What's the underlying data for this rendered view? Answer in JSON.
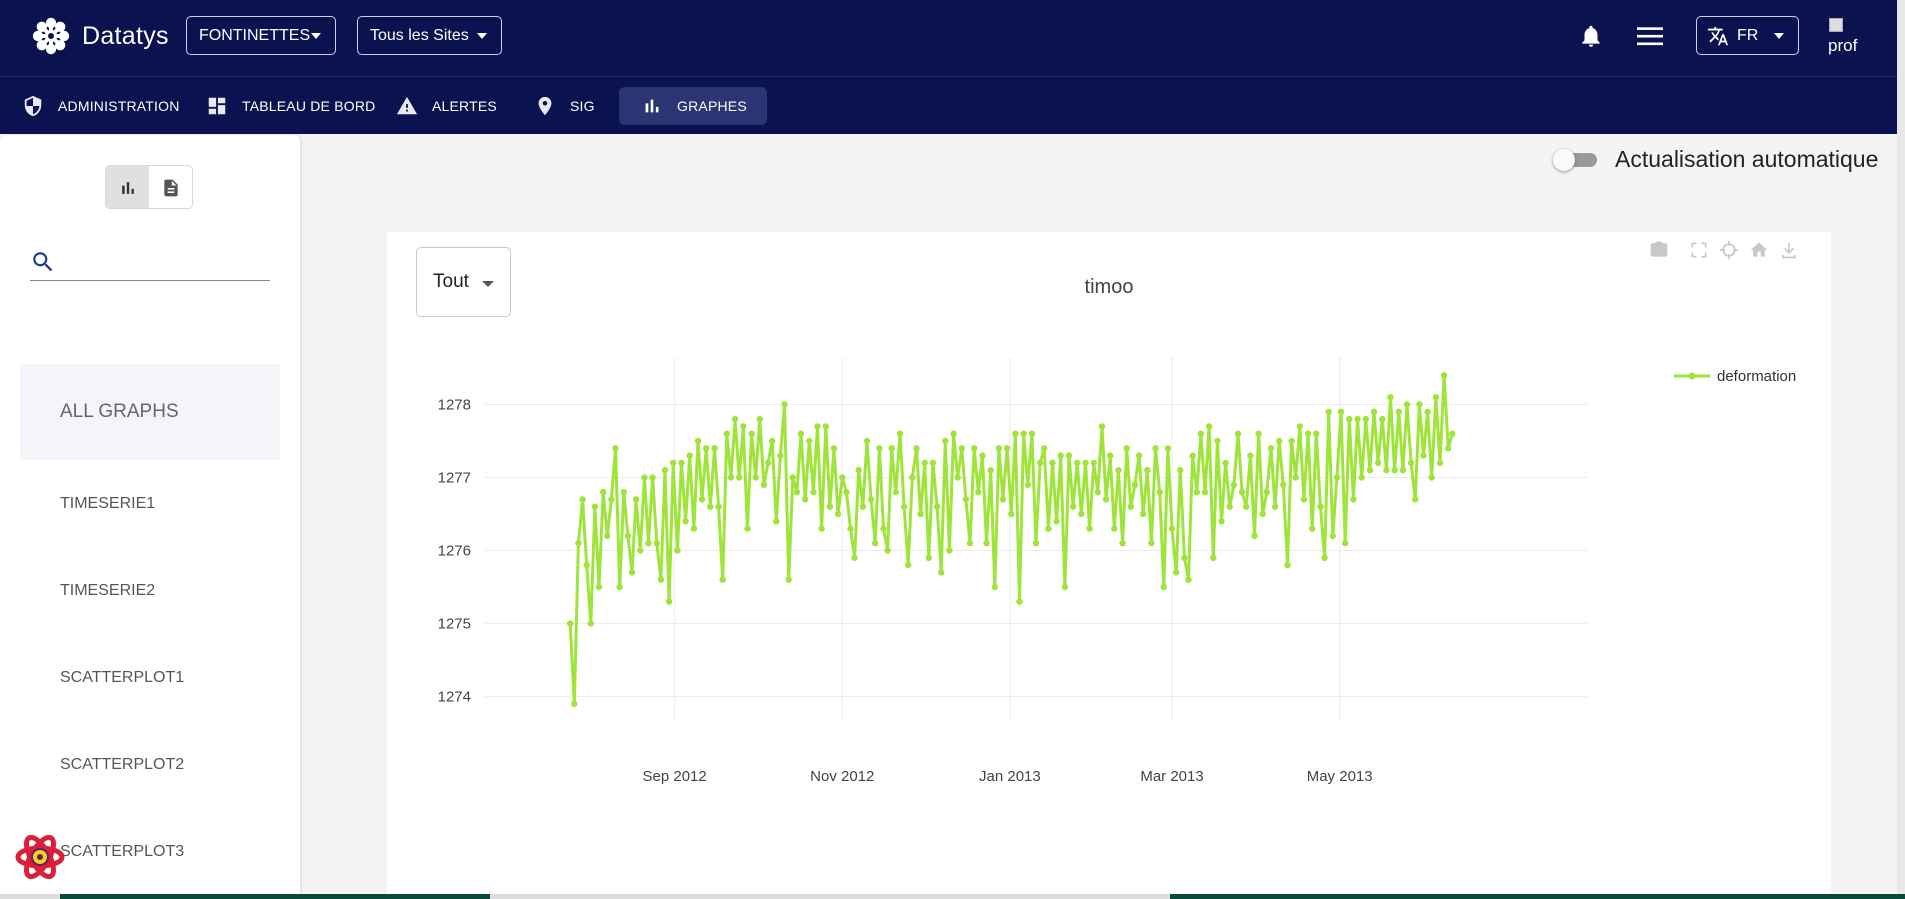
{
  "header": {
    "brand": "Datatys",
    "site_group": "FONTINETTES",
    "site_filter": "Tous les Sites",
    "language": "FR",
    "avatar_alt": "prof"
  },
  "nav": [
    {
      "label": "ADMINISTRATION",
      "icon": "shield-icon"
    },
    {
      "label": "TABLEAU DE BORD",
      "icon": "dashboard-icon"
    },
    {
      "label": "ALERTES",
      "icon": "warning-icon"
    },
    {
      "label": "SIG",
      "icon": "map-pin-icon"
    },
    {
      "label": "GRAPHES",
      "icon": "bar-chart-icon",
      "active": true
    }
  ],
  "sidebar": {
    "search": {
      "value": "",
      "placeholder": ""
    },
    "items": [
      "ALL GRAPHS",
      "TIMESERIE1",
      "TIMESERIE2",
      "SCATTERPLOT1",
      "SCATTERPLOT2",
      "SCATTERPLOT3"
    ],
    "selected": "ALL GRAPHS"
  },
  "main": {
    "auto_refresh_label": "Actualisation automatique",
    "auto_refresh_on": false,
    "range_select": "Tout"
  },
  "colors": {
    "navy": "#0a1250",
    "series": "#9ee43b"
  },
  "chart_data": {
    "type": "line",
    "title": "timoo",
    "xlabel": "",
    "ylabel": "",
    "x_ticks": [
      "Sep 2012",
      "Nov 2012",
      "Jan 2013",
      "Mar 2013",
      "May 2013"
    ],
    "y_ticks": [
      1274,
      1275,
      1276,
      1277,
      1278
    ],
    "ylim": [
      1273.65,
      1278.65
    ],
    "xlim": [
      "2012-06-24",
      "2013-07-30"
    ],
    "grid": true,
    "legend_position": "top-right",
    "series": [
      {
        "name": "deformation",
        "color": "#9ee43b",
        "x_start": "2012-07-25",
        "step_days": 1.5,
        "values": [
          1275.0,
          1273.9,
          1276.1,
          1276.7,
          1275.8,
          1275.0,
          1276.6,
          1275.5,
          1276.8,
          1276.2,
          1276.7,
          1277.4,
          1275.5,
          1276.8,
          1276.2,
          1275.7,
          1276.7,
          1276.0,
          1277.0,
          1276.1,
          1277.0,
          1276.1,
          1275.6,
          1277.1,
          1275.3,
          1277.2,
          1276.0,
          1277.2,
          1276.4,
          1277.3,
          1276.3,
          1277.5,
          1276.7,
          1277.4,
          1276.6,
          1277.4,
          1276.6,
          1275.6,
          1277.6,
          1277.0,
          1277.8,
          1277.0,
          1277.7,
          1276.3,
          1277.6,
          1277.0,
          1277.8,
          1276.9,
          1277.2,
          1277.5,
          1276.4,
          1277.3,
          1278.0,
          1275.6,
          1277.0,
          1276.8,
          1277.6,
          1276.7,
          1277.5,
          1276.8,
          1277.7,
          1276.3,
          1277.7,
          1276.6,
          1277.4,
          1276.5,
          1277.0,
          1276.8,
          1276.3,
          1275.9,
          1277.1,
          1276.6,
          1277.5,
          1276.7,
          1276.1,
          1277.4,
          1276.3,
          1276.0,
          1277.4,
          1276.8,
          1277.6,
          1276.6,
          1275.8,
          1277.0,
          1277.4,
          1276.5,
          1277.2,
          1275.9,
          1277.2,
          1276.6,
          1275.7,
          1277.5,
          1276.0,
          1277.6,
          1277.0,
          1277.4,
          1276.7,
          1276.1,
          1277.4,
          1276.8,
          1277.3,
          1276.1,
          1277.1,
          1275.5,
          1277.4,
          1276.7,
          1277.4,
          1276.5,
          1277.6,
          1275.3,
          1277.6,
          1276.9,
          1277.6,
          1276.1,
          1277.2,
          1277.4,
          1276.3,
          1277.2,
          1276.4,
          1277.3,
          1275.5,
          1277.3,
          1276.6,
          1277.2,
          1276.5,
          1277.2,
          1276.3,
          1277.2,
          1276.8,
          1277.7,
          1276.7,
          1277.3,
          1276.3,
          1277.1,
          1276.1,
          1277.4,
          1276.6,
          1276.9,
          1277.3,
          1276.5,
          1277.1,
          1276.1,
          1277.4,
          1276.8,
          1275.5,
          1277.4,
          1276.3,
          1275.7,
          1277.1,
          1275.9,
          1275.6,
          1277.3,
          1276.8,
          1277.6,
          1276.8,
          1277.7,
          1275.9,
          1277.5,
          1276.4,
          1277.2,
          1276.6,
          1276.9,
          1277.6,
          1276.8,
          1276.6,
          1277.3,
          1276.2,
          1277.6,
          1276.5,
          1276.8,
          1277.4,
          1276.6,
          1277.5,
          1276.9,
          1275.8,
          1277.5,
          1277.0,
          1277.7,
          1276.7,
          1277.6,
          1276.3,
          1277.6,
          1276.6,
          1275.9,
          1277.9,
          1276.2,
          1277.0,
          1277.9,
          1276.1,
          1277.8,
          1276.7,
          1277.8,
          1277.0,
          1277.8,
          1277.1,
          1277.9,
          1277.2,
          1277.8,
          1277.1,
          1278.1,
          1277.1,
          1277.9,
          1277.1,
          1278.0,
          1277.2,
          1276.7,
          1278.0,
          1277.3,
          1277.9,
          1277.0,
          1278.1,
          1277.2,
          1278.4,
          1277.4,
          1277.6
        ]
      }
    ]
  }
}
